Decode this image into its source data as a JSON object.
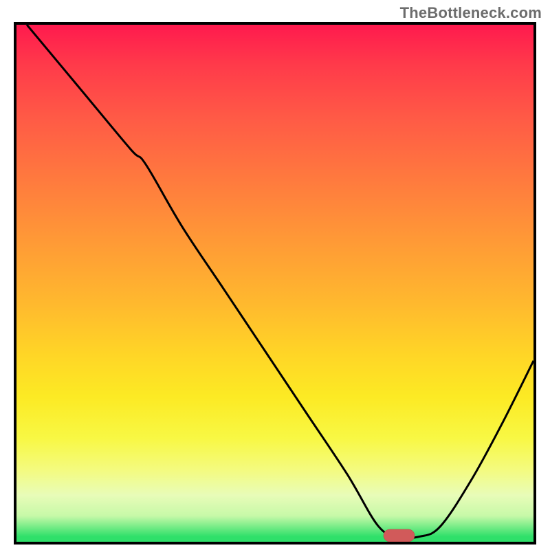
{
  "watermark": "TheBottleneck.com",
  "chart_data": {
    "type": "line",
    "title": "",
    "xlabel": "",
    "ylabel": "",
    "xlim": [
      0,
      100
    ],
    "ylim": [
      0,
      100
    ],
    "grid": false,
    "legend": false,
    "curve_note": "Black curve drops from top-left with a mild slope-break near x≈25, nearly reaches 0 around x≈70–78 (flat bottom), then rises toward x=100.",
    "series": [
      {
        "name": "curve",
        "x": [
          2,
          12,
          22,
          25,
          32,
          40,
          48,
          56,
          64,
          70,
          74,
          78,
          82,
          88,
          94,
          100
        ],
        "values": [
          100,
          88,
          76,
          73,
          61,
          49,
          37,
          25,
          13,
          3,
          1,
          1,
          3,
          12,
          23,
          35
        ]
      }
    ],
    "marker": {
      "label": "optimal-band",
      "x_center": 74,
      "y": 0.8,
      "width": 6
    },
    "gradient_stops": [
      {
        "pct": 0,
        "color": "#ff1a4e"
      },
      {
        "pct": 8,
        "color": "#ff3b4a"
      },
      {
        "pct": 18,
        "color": "#ff5a46"
      },
      {
        "pct": 30,
        "color": "#ff7a3e"
      },
      {
        "pct": 42,
        "color": "#ff9a36"
      },
      {
        "pct": 54,
        "color": "#ffb92e"
      },
      {
        "pct": 64,
        "color": "#ffd626"
      },
      {
        "pct": 72,
        "color": "#fcea24"
      },
      {
        "pct": 80,
        "color": "#f8f844"
      },
      {
        "pct": 86,
        "color": "#f4fb7e"
      },
      {
        "pct": 91,
        "color": "#e8fcb8"
      },
      {
        "pct": 95,
        "color": "#c7f9a8"
      },
      {
        "pct": 99,
        "color": "#2fe06a"
      },
      {
        "pct": 100,
        "color": "#2fe06a"
      }
    ]
  }
}
